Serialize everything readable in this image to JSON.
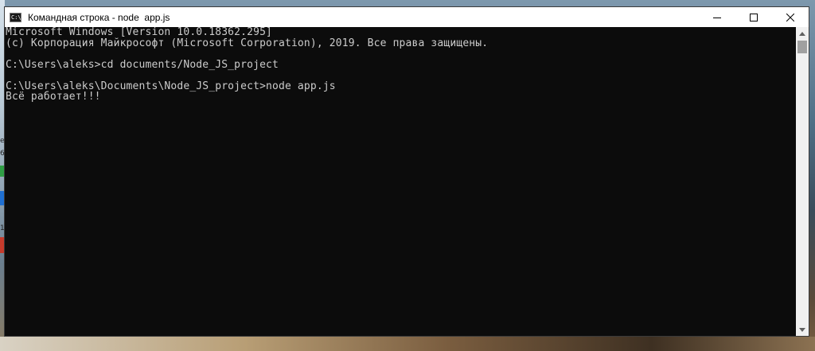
{
  "window": {
    "title": "Командная строка - node  app.js",
    "icon_text": "C:\\"
  },
  "console": {
    "lines": [
      "Microsoft Windows [Version 10.0.18362.295]",
      "(c) Корпорация Майкрософт (Microsoft Corporation), 2019. Все права защищены.",
      "",
      "C:\\Users\\aleks>cd documents/Node_JS_project",
      "",
      "C:\\Users\\aleks\\Documents\\Node_JS_project>node app.js",
      "Всё работает!!!"
    ]
  },
  "desktop": {
    "marks": [
      "e",
      "6",
      "1"
    ]
  },
  "icons": {
    "minimize": "minimize-icon",
    "maximize": "maximize-icon",
    "close": "close-icon",
    "scroll_up": "chevron-up-icon",
    "scroll_down": "chevron-down-icon"
  }
}
